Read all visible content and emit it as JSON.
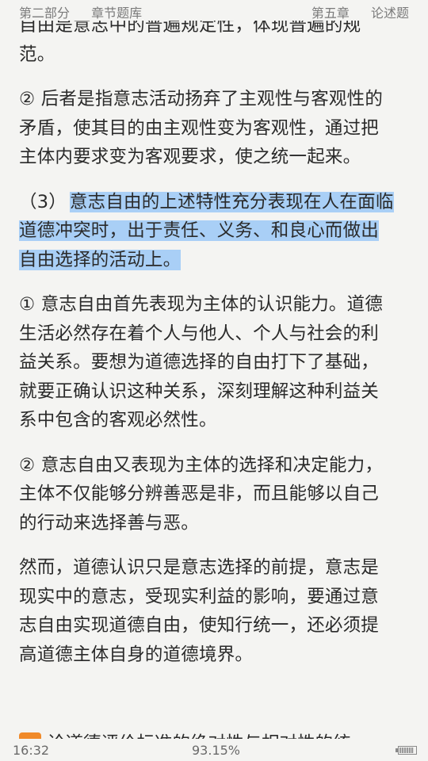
{
  "header": {
    "part": "第二部分",
    "section": "章节题库",
    "chapter": "第五章",
    "type": "论述题"
  },
  "paragraphs": [
    {
      "lines": [
        "自由是意志中的普遍规定性，体现普遍的规",
        "范。"
      ]
    },
    {
      "lines": [
        "② 后者是指意志活动扬弃了主观性与客观性的",
        "矛盾，使其目的由主观性变为客观性，通过把",
        "主体内要求变为客观要求，使之统一起来。"
      ]
    },
    {
      "prefix": "（3）",
      "highlight": true,
      "lines": [
        "意志自由的上述特性充分表现在人在面临",
        "道德冲突时，出于责任、义务、和良心而做出",
        "自由选择的活动上。"
      ]
    },
    {
      "lines": [
        "① 意志自由首先表现为主体的认识能力。道德",
        "生活必然存在着个人与他人、个人与社会的利",
        "益关系。要想为道德选择的自由打下了基础，",
        "就要正确认识这种关系，深刻理解这种利益关",
        "系中包含的客观必然性。"
      ]
    },
    {
      "lines": [
        "② 意志自由又表现为主体的选择和决定能力，",
        "主体不仅能够分辨善恶是非，而且能够以自己",
        "的行动来选择善与恶。"
      ]
    },
    {
      "lines": [
        "然而，道德认识只是意志选择的前提，意志是",
        "现实中的意志，受现实利益的影响，要通过意",
        "志自由实现道德自由，使知行统一，还必须提",
        "高道德主体自身的道德境界。"
      ]
    }
  ],
  "next_question_partial": "论道德评价标准的绝对性与相对性的统",
  "footer": {
    "time": "16:32",
    "progress": "93.15%",
    "battery_level": 0.9
  },
  "colors": {
    "background": "#f4f4f2",
    "highlight": "#a9cff6",
    "badge": "#f08a2a"
  }
}
